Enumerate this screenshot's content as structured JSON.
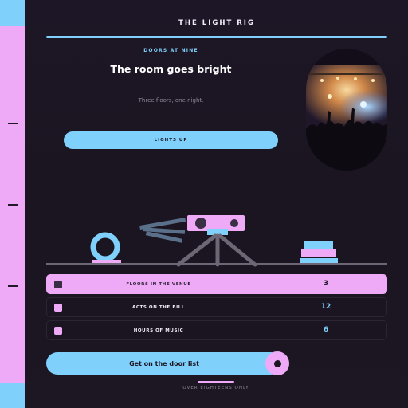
{
  "brand": "THE LIGHT RIG",
  "hero": {
    "kicker": "DOORS AT NINE",
    "headline": "The room goes bright",
    "subline": "Three floors, one night.",
    "button": "LIGHTS UP"
  },
  "stats": [
    {
      "label": "FLOORS IN THE VENUE",
      "value": "3",
      "active": true
    },
    {
      "label": "ACTS ON THE BILL",
      "value": "12",
      "active": false
    },
    {
      "label": "HOURS OF MUSIC",
      "value": "6",
      "active": false
    }
  ],
  "cta": {
    "label": "Get on the door list"
  },
  "footer": {
    "note": "OVER EIGHTEENS ONLY"
  },
  "colors": {
    "accent_blue": "#7fd0fb",
    "accent_pink": "#efaaf7",
    "background": "#1a1520"
  },
  "icons": [
    "ring-icon",
    "projector-icon",
    "tripod-icon",
    "stacked-books-icon",
    "concert-crowd-photo"
  ]
}
